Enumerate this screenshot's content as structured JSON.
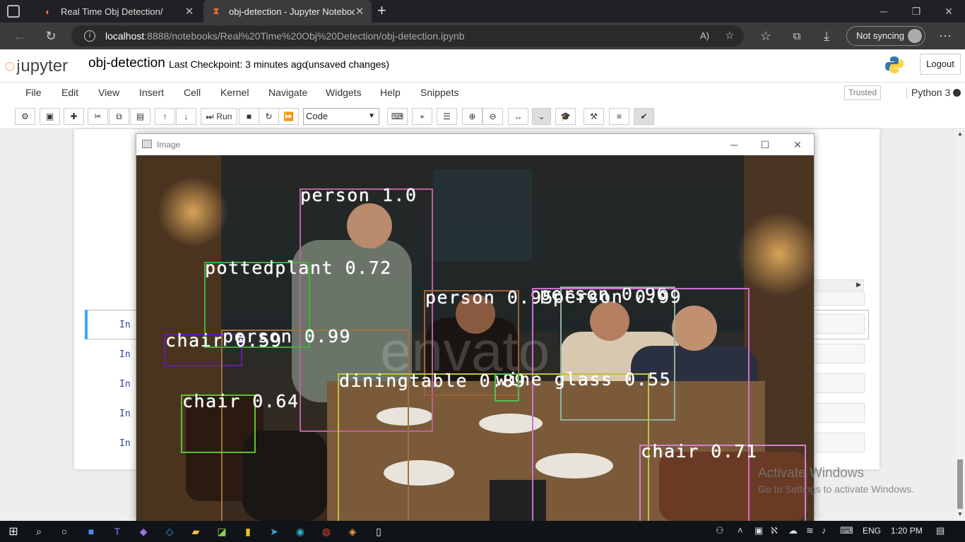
{
  "browser": {
    "tabs": [
      {
        "title": "Real Time Obj Detection/",
        "active": false
      },
      {
        "title": "obj-detection - Jupyter Noteboo",
        "active": true
      }
    ],
    "url_host": "localhost",
    "url_rest": ":8888/notebooks/Real%20Time%20Obj%20Detection/obj-detection.ipynb",
    "sync_label": "Not syncing"
  },
  "jupyter": {
    "logo_text": "upyter",
    "notebook_name": "obj-detection",
    "checkpoint": "Last Checkpoint: 3 minutes ago",
    "status": "(unsaved changes)",
    "logout": "Logout",
    "menu": [
      "File",
      "Edit",
      "View",
      "Insert",
      "Cell",
      "Kernel",
      "Navigate",
      "Widgets",
      "Help",
      "Snippets"
    ],
    "trusted": "Trusted",
    "kernel": "Python 3",
    "run_label": "Run",
    "cell_type": "Code",
    "cell_prompts": [
      "In",
      "In",
      "In",
      "In",
      "In"
    ]
  },
  "image_window": {
    "title": "Image",
    "watermark": "envato",
    "detections": [
      {
        "label": "person 1.0",
        "color": "#c060a0"
      },
      {
        "label": "pottedplant 0.72",
        "color": "#40b040"
      },
      {
        "label": "chair 0.59",
        "color": "#6020a0"
      },
      {
        "label": "person 0.99",
        "color": "#a07040"
      },
      {
        "label": "person 0.95",
        "color": "#a06030"
      },
      {
        "label": "person 0.96",
        "color": "#d070d0"
      },
      {
        "label": "person 0.99",
        "color": "#90b0a0"
      },
      {
        "label": "diningtable 0.89",
        "color": "#c0c040"
      },
      {
        "label": "wine glass 0.55",
        "color": "#50c050"
      },
      {
        "label": "chair 0.64",
        "color": "#60c030"
      },
      {
        "label": "chair 0.71",
        "color": "#d080d0"
      }
    ]
  },
  "os": {
    "activate_title": "Activate Windows",
    "activate_sub": "Go to Settings to activate Windows.",
    "lang": "ENG",
    "time": "1:20 PM"
  }
}
